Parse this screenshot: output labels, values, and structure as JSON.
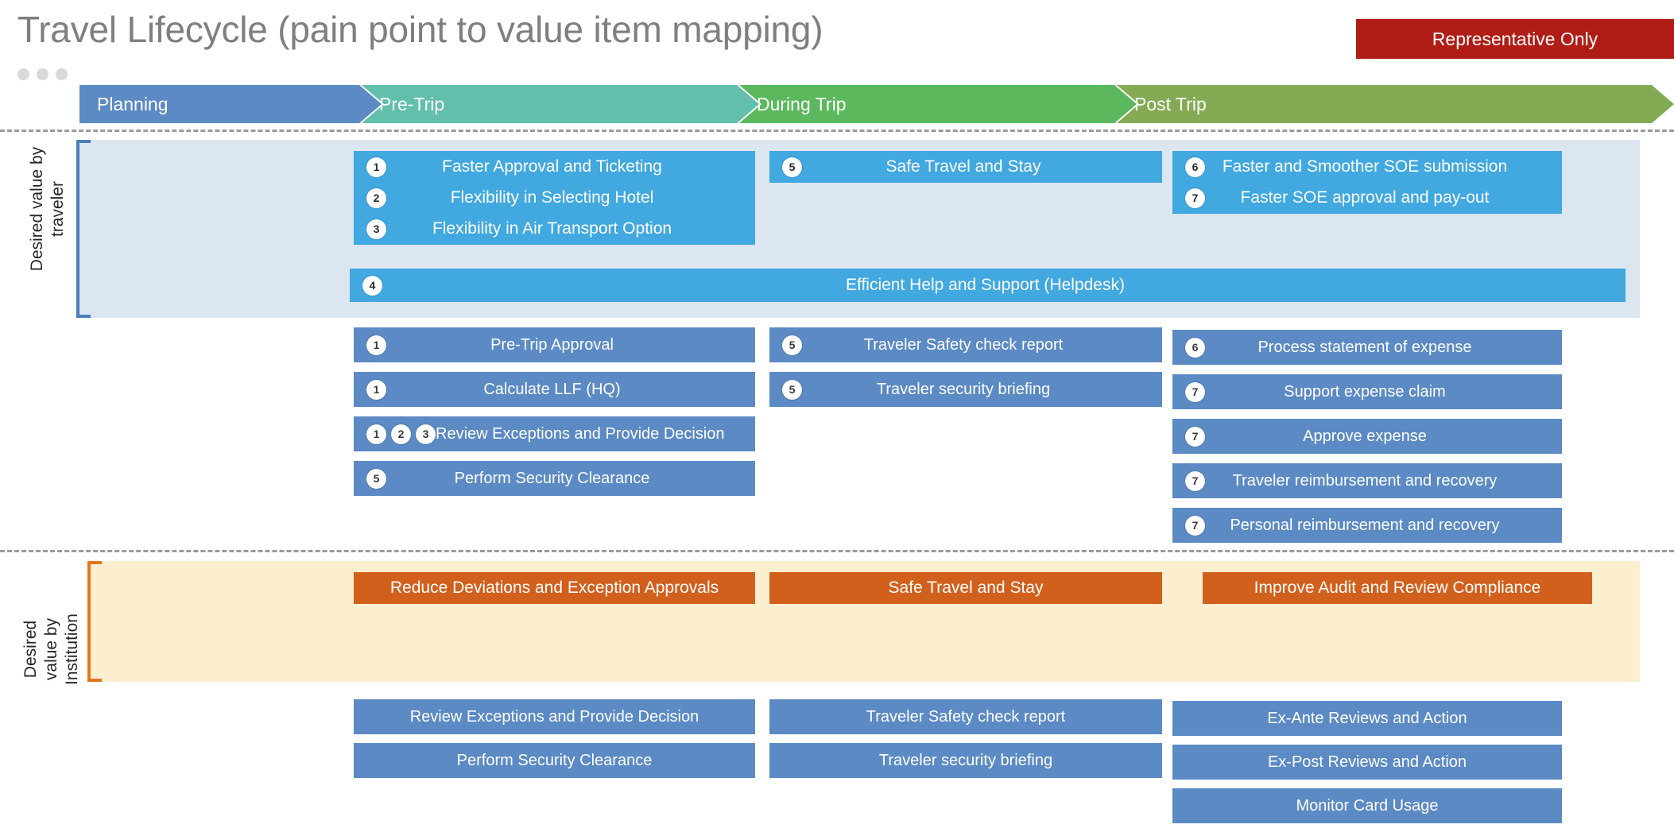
{
  "page": {
    "title": "Travel Lifecycle (pain point to value item mapping)",
    "banner": "Representative Only",
    "dots_icon": "slide-dots-icon"
  },
  "colors": {
    "phase_planning": "#5b8ac4",
    "phase_pretrip": "#61bfab",
    "phase_during": "#5cb85c",
    "phase_post": "#84ab54",
    "traveler_panel": "#dce6f1",
    "traveler_box": "#41a8e0",
    "process_box": "#5b8ac4",
    "institution_panel": "#fcefcf",
    "institution_box": "#d2601d",
    "banner_red": "#b01c16",
    "title_gray": "#7f7f7f"
  },
  "phases": [
    {
      "label": "Planning"
    },
    {
      "label": "Pre-Trip"
    },
    {
      "label": "During Trip"
    },
    {
      "label": "Post Trip"
    }
  ],
  "sections": {
    "traveler": {
      "label_line1": "Desired value by",
      "label_line2": "traveler"
    },
    "institution": {
      "label_line1": "Desired",
      "label_line2": "value by",
      "label_line3": "Institution"
    }
  },
  "traveler_values": {
    "pretrip": [
      {
        "badges": [
          "1"
        ],
        "label": "Faster Approval and Ticketing"
      },
      {
        "badges": [
          "2"
        ],
        "label": "Flexibility in Selecting Hotel"
      },
      {
        "badges": [
          "3"
        ],
        "label": "Flexibility in Air Transport Option"
      }
    ],
    "during": [
      {
        "badges": [
          "5"
        ],
        "label": "Safe Travel and Stay"
      }
    ],
    "post": [
      {
        "badges": [
          "6"
        ],
        "label": "Faster and Smoother SOE submission"
      },
      {
        "badges": [
          "7"
        ],
        "label": "Faster SOE approval and pay-out"
      }
    ],
    "fullwidth": {
      "badges": [
        "4"
      ],
      "label": "Efficient Help and Support (Helpdesk)"
    }
  },
  "traveler_processes": {
    "pretrip": [
      {
        "badges": [
          "1"
        ],
        "label": "Pre-Trip Approval"
      },
      {
        "badges": [
          "1"
        ],
        "label": "Calculate LLF (HQ)"
      },
      {
        "badges": [
          "1",
          "2",
          "3"
        ],
        "label": "Review Exceptions and Provide Decision"
      },
      {
        "badges": [
          "5"
        ],
        "label": "Perform Security Clearance"
      }
    ],
    "during": [
      {
        "badges": [
          "5"
        ],
        "label": "Traveler Safety check report"
      },
      {
        "badges": [
          "5"
        ],
        "label": "Traveler security briefing"
      }
    ],
    "post": [
      {
        "badges": [
          "6"
        ],
        "label": "Process statement of expense"
      },
      {
        "badges": [
          "7"
        ],
        "label": "Support expense claim"
      },
      {
        "badges": [
          "7"
        ],
        "label": "Approve expense"
      },
      {
        "badges": [
          "7"
        ],
        "label": "Traveler reimbursement and recovery"
      },
      {
        "badges": [
          "7"
        ],
        "label": "Personal reimbursement and recovery"
      }
    ]
  },
  "institution_values": {
    "pretrip": [
      {
        "label": "Reduce Deviations and Exception Approvals"
      }
    ],
    "during": [
      {
        "label": "Safe Travel and Stay"
      }
    ],
    "post": [
      {
        "label": "Improve Audit and Review Compliance"
      }
    ]
  },
  "institution_processes": {
    "pretrip": [
      {
        "label": "Review Exceptions and Provide Decision"
      },
      {
        "label": "Perform Security Clearance"
      }
    ],
    "during": [
      {
        "label": "Traveler Safety check report"
      },
      {
        "label": "Traveler security briefing"
      }
    ],
    "post": [
      {
        "label": "Ex-Ante Reviews and Action"
      },
      {
        "label": "Ex-Post Reviews and Action"
      },
      {
        "label": "Monitor Card Usage"
      }
    ]
  }
}
